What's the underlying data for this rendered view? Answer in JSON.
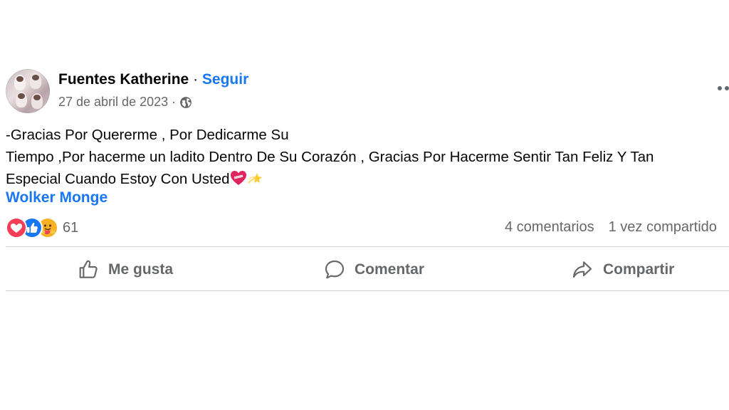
{
  "post": {
    "author": "Fuentes Katherine",
    "separator": "·",
    "follow_label": "Seguir",
    "date": "27 de abril de 2023",
    "date_separator": "·",
    "privacy_icon": "globe-icon",
    "text_lines": [
      "-Gracias Por Quererme , Por Dedicarme Su",
      "Tiempo ,Por hacerme un ladito Dentro De Su Corazón , Gracias Por Hacerme Sentir Tan Feliz Y Tan",
      "Especial Cuando Estoy Con Usted"
    ],
    "emojis": [
      "❤️‍🩹",
      "💫"
    ],
    "tagged_person": "Wolker Monge"
  },
  "reactions": {
    "icons": [
      "love-icon",
      "like-icon",
      "care-icon"
    ],
    "count": "61",
    "comments": "4 comentarios",
    "shares": "1 vez compartido"
  },
  "actions": {
    "like_label": "Me gusta",
    "comment_label": "Comentar",
    "share_label": "Compartir"
  },
  "colors": {
    "link_blue": "#1877f2",
    "secondary_text": "#65676b",
    "divider": "#ced0d4",
    "love_red": "#f33e58",
    "like_blue": "#1877f2",
    "care_yellow": "#f7b125"
  }
}
